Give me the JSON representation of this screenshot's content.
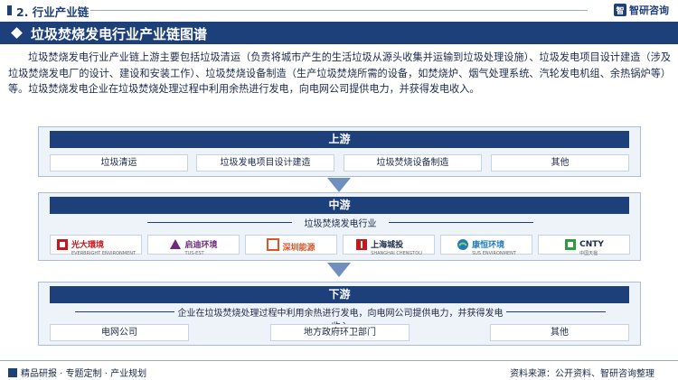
{
  "header": {
    "section": "2. 行业产业链",
    "brand_name": "智研咨询",
    "brand_logo_letter": "智"
  },
  "title": "垃圾焚烧发电行业产业链图谱",
  "intro": "垃圾焚烧发电行业产业链上游主要包括垃圾清运（负责将城市产生的生活垃圾从源头收集并运输到垃圾处理设施）、垃圾发电项目设计建造（涉及垃圾焚烧发电厂的设计、建设和安装工作）、垃圾焚烧设备制造（生产垃圾焚烧所需的设备，如焚烧炉、烟气处理系统、汽轮发电机组、余热锅炉等）等。垃圾焚烧发电企业在垃圾焚烧处理过程中利用余热进行发电，向电网公司提供电力，并获得发电收入。",
  "upstream": {
    "label": "上游",
    "items": [
      "垃圾清运",
      "垃圾发电项目设计建造",
      "垃圾焚烧设备制造",
      "其他"
    ]
  },
  "midstream": {
    "label": "中游",
    "subhead": "垃圾焚烧发电行业",
    "companies": [
      {
        "name": "光大環境",
        "sub": "EVERBRIGHT ENVIRONMENT",
        "color": "#c8161d",
        "icon": "everbright-logo-icon"
      },
      {
        "name": "启迪环境",
        "sub": "TUS-EST",
        "color": "#6b2a7a",
        "icon": "tus-est-logo-icon"
      },
      {
        "name": "深圳能源",
        "sub": "",
        "color": "#d9552a",
        "icon": "shenzhen-energy-logo-icon"
      },
      {
        "name": "上海城投",
        "sub": "SHANGHAI CHENGTOU",
        "color": "#c8161d",
        "icon": "shanghai-chengtou-logo-icon"
      },
      {
        "name": "康恒环境",
        "sub": "SUS ENVIRONMENT",
        "color": "#1e7bbf",
        "icon": "sus-env-logo-icon"
      },
      {
        "name": "CNTY",
        "sub": "中国天楹",
        "color": "#2e9b3e",
        "icon": "cnty-logo-icon"
      }
    ]
  },
  "downstream": {
    "label": "下游",
    "subhead": "企业在垃圾焚烧处理过程中利用余热进行发电，向电网公司提供电力，并获得发电收入",
    "items": [
      "电网公司",
      "地方政府环卫部门",
      "其他"
    ]
  },
  "footer": {
    "left": "精品研报 · 专题定制 · 产业规划",
    "source": "资料来源：公开资料、智研咨询整理"
  },
  "colors": {
    "navy": "#1d3f7a",
    "panel_bg": "#eef3fa",
    "arrow": "#6f8fc0"
  }
}
